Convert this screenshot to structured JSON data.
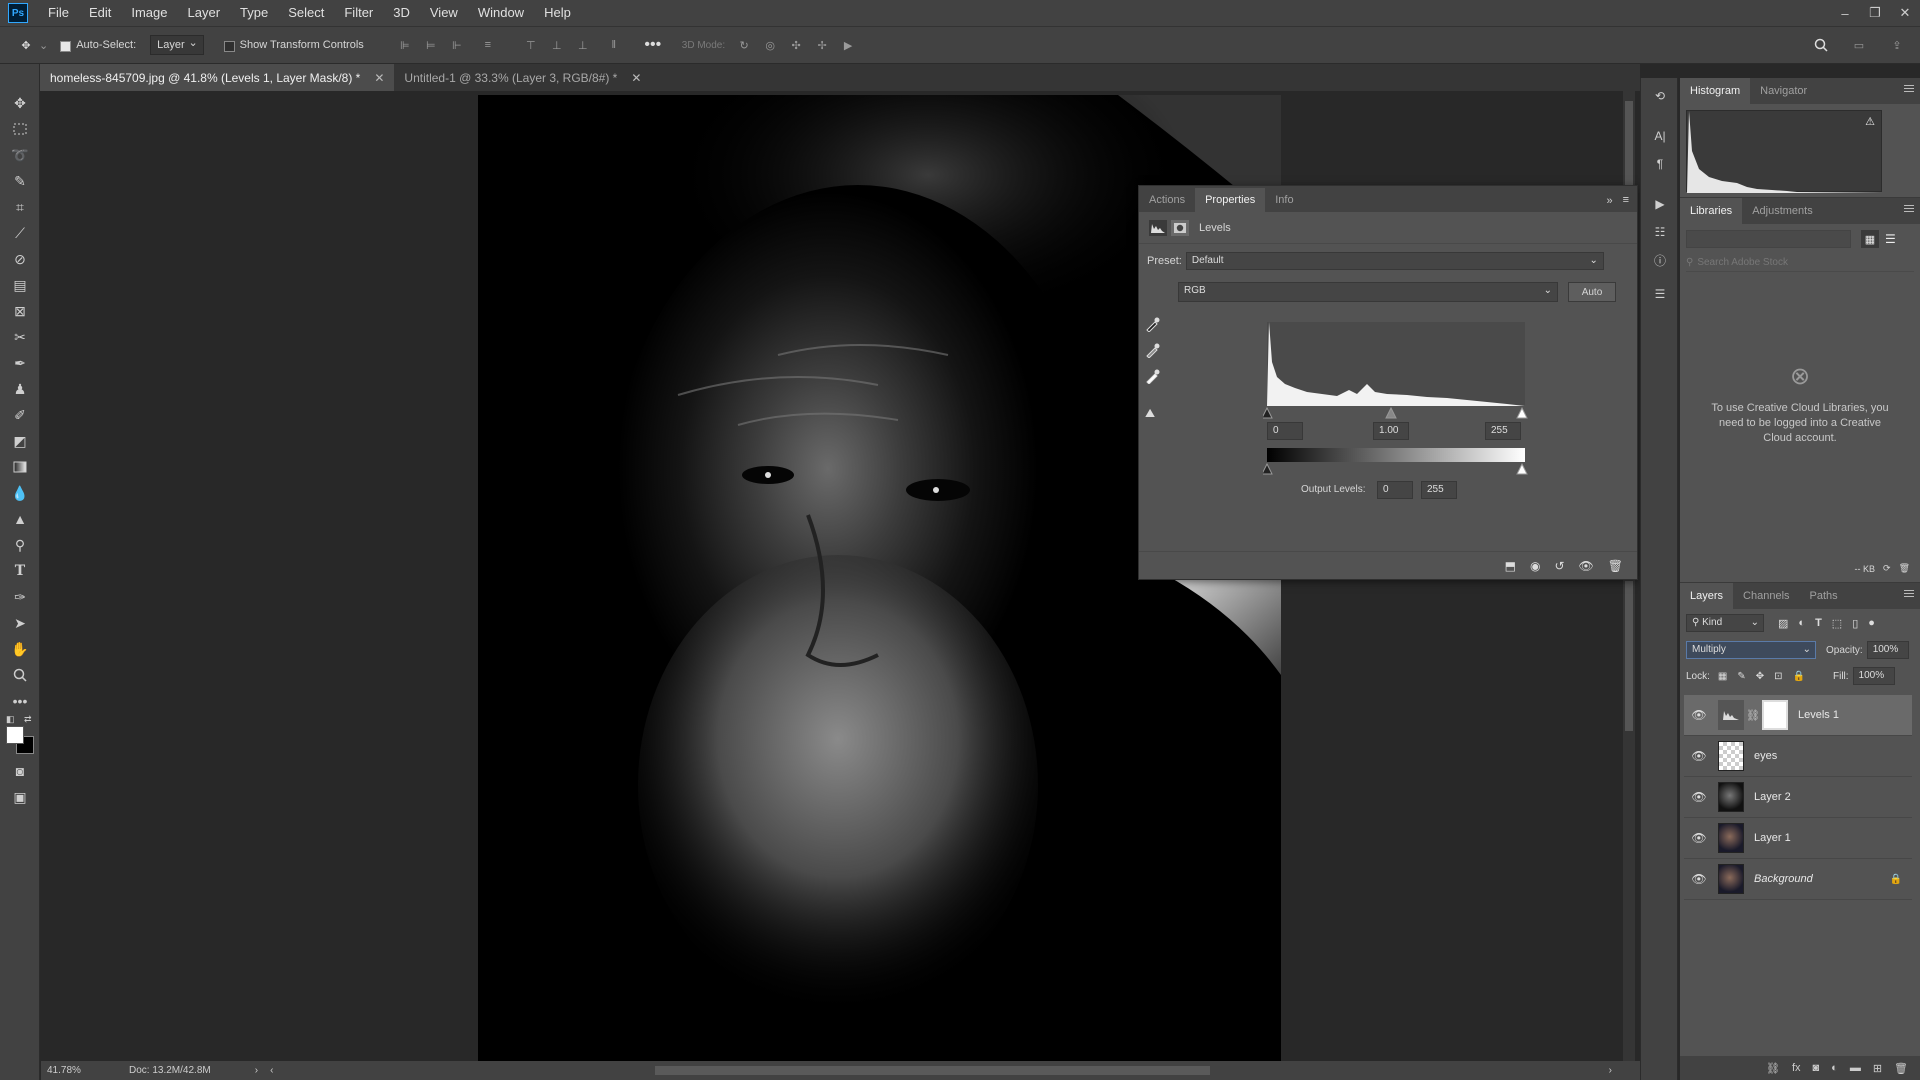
{
  "app": {
    "logo": "Ps"
  },
  "menu": [
    "File",
    "Edit",
    "Image",
    "Layer",
    "Type",
    "Select",
    "Filter",
    "3D",
    "View",
    "Window",
    "Help"
  ],
  "window_controls": [
    "–",
    "❐",
    "✕"
  ],
  "options": {
    "auto_select_label": "Auto-Select:",
    "auto_select_checked": true,
    "auto_select_target": "Layer",
    "transform_label": "Show Transform Controls",
    "mode_3d_label": "3D Mode:"
  },
  "tabs": [
    {
      "label": "homeless-845709.jpg @ 41.8% (Levels 1, Layer Mask/8) *",
      "active": true
    },
    {
      "label": "Untitled-1 @ 33.3% (Layer 3, RGB/8#) *",
      "active": false
    }
  ],
  "status": {
    "zoom": "41.78%",
    "doc": "Doc: 13.2M/42.8M"
  },
  "properties": {
    "tabs": [
      "Actions",
      "Properties",
      "Info"
    ],
    "active_tab": "Properties",
    "adjustment_name": "Levels",
    "preset_label": "Preset:",
    "preset_value": "Default",
    "channel": "RGB",
    "auto_label": "Auto",
    "input_black": "0",
    "input_gamma": "1.00",
    "input_white": "255",
    "output_label": "Output Levels:",
    "output_black": "0",
    "output_white": "255"
  },
  "histogram_panel": {
    "tabs": [
      "Histogram",
      "Navigator"
    ],
    "active_tab": "Histogram"
  },
  "libraries_panel": {
    "tabs": [
      "Libraries",
      "Adjustments"
    ],
    "active_tab": "Libraries",
    "search_placeholder": "Search Adobe Stock",
    "message": "To use Creative Cloud Libraries, you need to be logged into a Creative Cloud account.",
    "size_label": "-- KB"
  },
  "layers_panel": {
    "tabs": [
      "Layers",
      "Channels",
      "Paths"
    ],
    "active_tab": "Layers",
    "kind_label": "Kind",
    "blend_mode": "Multiply",
    "opacity_label": "Opacity:",
    "opacity_value": "100%",
    "lock_label": "Lock:",
    "fill_label": "Fill:",
    "fill_value": "100%",
    "layers": [
      {
        "name": "Levels 1",
        "type": "adjustment",
        "selected": true,
        "visible": true
      },
      {
        "name": "eyes",
        "type": "transparent",
        "selected": false,
        "visible": true
      },
      {
        "name": "Layer 2",
        "type": "photo",
        "selected": false,
        "visible": true
      },
      {
        "name": "Layer 1",
        "type": "photo",
        "selected": false,
        "visible": true
      },
      {
        "name": "Background",
        "type": "photo",
        "selected": false,
        "visible": true,
        "locked": true
      }
    ]
  }
}
